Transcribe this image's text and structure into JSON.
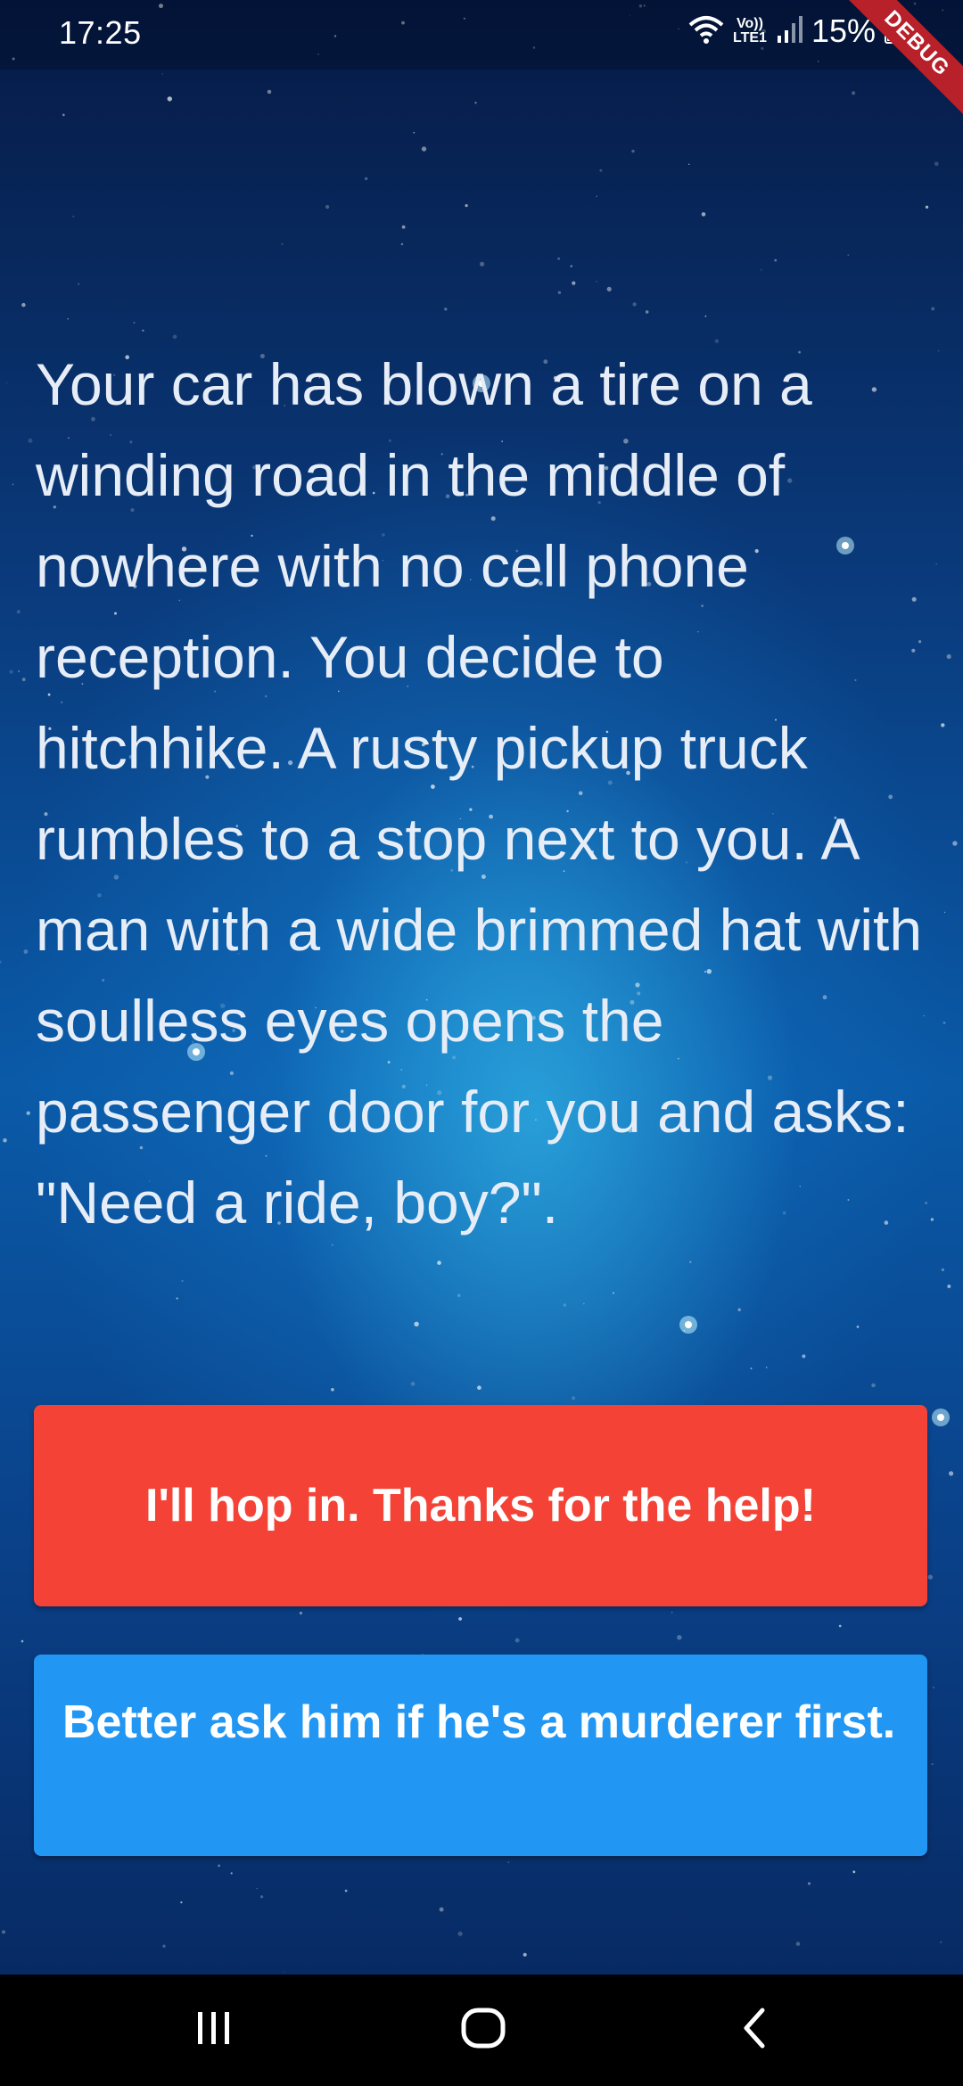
{
  "status_bar": {
    "time": "17:25",
    "network_label_top": "Vo))",
    "network_label_bottom": "LTE1",
    "battery": "15%"
  },
  "debug_banner": "DEBUG",
  "story": {
    "text": "Your car has blown a tire on a winding road in the middle of nowhere with no cell phone reception. You decide to hitchhike. A rusty pickup truck rumbles to a stop next to you. A man with a wide brimmed hat with soulless eyes opens the passenger door for you and asks: \"Need a ride, boy?\"."
  },
  "choices": [
    {
      "label": "I'll hop in. Thanks for the help!",
      "color": "#f44336"
    },
    {
      "label": "Better ask him if he's a murderer first.",
      "color": "#2196f3"
    }
  ],
  "icons": {
    "wifi": "wifi-icon",
    "signal": "signal-icon",
    "battery": "battery-icon",
    "recents": "recents-icon",
    "home": "home-icon",
    "back": "back-icon"
  }
}
